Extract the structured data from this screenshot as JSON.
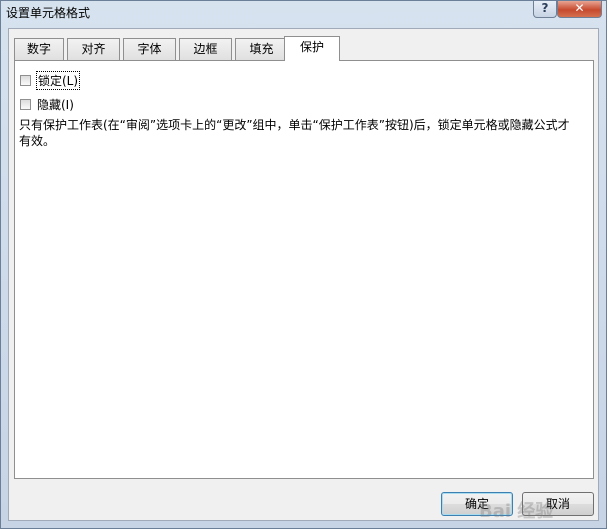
{
  "window": {
    "title": "设置单元格格式",
    "help_label": "?",
    "close_label": "✕"
  },
  "tabs": [
    {
      "label": "数字"
    },
    {
      "label": "对齐"
    },
    {
      "label": "字体"
    },
    {
      "label": "边框"
    },
    {
      "label": "填充"
    },
    {
      "label": "保护",
      "active": true
    }
  ],
  "protection": {
    "locked_label": "锁定(L)",
    "locked_checked": false,
    "hidden_label": "隐藏(I)",
    "hidden_checked": false,
    "description": "只有保护工作表(在“审阅”选项卡上的“更改”组中，单击“保护工作表”按钮)后，锁定单元格或隐藏公式才有效。"
  },
  "buttons": {
    "ok_label": "确定",
    "cancel_label": "取消"
  },
  "watermark": "Bai 经验"
}
